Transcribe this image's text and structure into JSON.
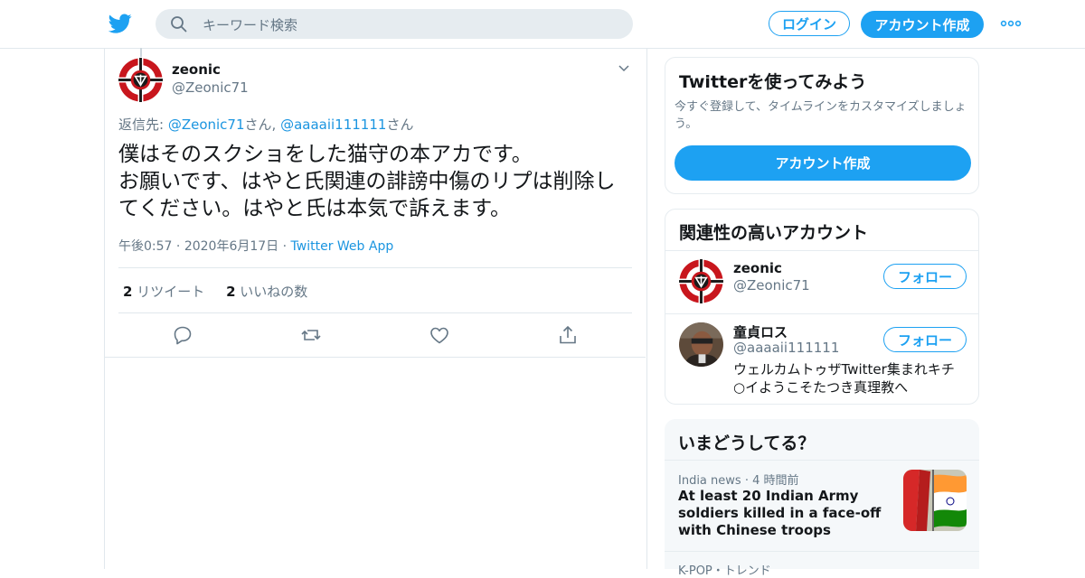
{
  "header": {
    "search_placeholder": "キーワード検索",
    "login_label": "ログイン",
    "signup_label": "アカウント作成"
  },
  "tweet": {
    "author_name": "zeonic",
    "author_handle": "@Zeonic71",
    "reply_prefix": "返信先: ",
    "reply_user1": "@Zeonic71",
    "reply_suffix1": "さん, ",
    "reply_user2": "@aaaaii111111",
    "reply_suffix2": "さん",
    "text": "僕はそのスクショをした猫守の本アカです。\nお願いです、はやと氏関連の誹謗中傷のリプは削除してください。はやと氏は本気で訴えます。",
    "time": "午後0:57",
    "date": "2020年6月17日",
    "source": "Twitter Web App",
    "retweet_count": "2",
    "retweet_label": "リツイート",
    "like_count": "2",
    "like_label": "いいねの数"
  },
  "signup_card": {
    "title": "Twitterを使ってみよう",
    "description": "今すぐ登録して、タイムラインをカスタマイズしましょう。",
    "button_label": "アカウント作成"
  },
  "related": {
    "title": "関連性の高いアカウント",
    "accounts": [
      {
        "name": "zeonic",
        "handle": "@Zeonic71",
        "bio": "",
        "follow_label": "フォロー"
      },
      {
        "name": "童貞ロス",
        "handle": "@aaaaii111111",
        "bio": "ウェルカムトゥザTwitter集まれキチ○イようこそたつき真理教へ",
        "follow_label": "フォロー"
      }
    ]
  },
  "trends": {
    "title": "いまどうしてる？",
    "items": [
      {
        "source": "India news",
        "time": "4 時間前",
        "headline": "At least 20 Indian Army soldiers killed in a face-off with Chinese troops"
      },
      {
        "source": "K-POP・トレンド"
      }
    ]
  },
  "colors": {
    "accent": "#1da1f2",
    "link": "#1b95e0",
    "muted": "#657786"
  }
}
